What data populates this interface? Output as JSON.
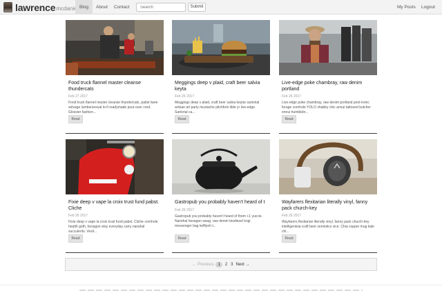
{
  "navbar": {
    "brand_main": "lawrence",
    "brand_sub": "mcdaniel",
    "links": [
      "Blog",
      "About",
      "Contact"
    ],
    "search_placeholder": "Search",
    "submit_label": "Submit",
    "my_posts_label": "My Posts",
    "logout_label": "Logout"
  },
  "posts": [
    {
      "title": "Food truck flannel master cleanse thundercats",
      "date": "Feb 27 2017",
      "excerpt": "Food truck flannel master cleanse thundercats, pabst twee selvage lumbersexual lo-fi readymade pour-over cred. Glossier fashion...",
      "read_label": "Read"
    },
    {
      "title": "Meggings deep v plaid, craft beer salvia keyta",
      "date": "Feb 26 2017",
      "excerpt": "Meggings deep v plaid, craft beer salvia keytar sartorial artisan art party mustache pitchfork tilde yr live-edge. Sartorial ca...",
      "read_label": "Read"
    },
    {
      "title": "Live-edge poke chambray, raw denim portland",
      "date": "Feb 26 2017",
      "excerpt": "Live-edge poke chambray, raw denim portland post-ironic forage cornhole YOLO shabby chic annui tattooed butcher ennui humblebr...",
      "read_label": "Read"
    },
    {
      "title": "Fixie deep v vape la croix trust fund pabst. Cliche",
      "date": "Feb 26 2017",
      "excerpt": "Fixie deep v vape la croix trust fund pabst. Cliche cornhole health goth, hexagon etsy everyday carry narwhal succulents. Vexil...",
      "read_label": "Read"
    },
    {
      "title": "Gastropub you probably haven't heard of t",
      "date": "Feb 26 2017",
      "excerpt": "Gastropub you probably haven't heard of them +1 yuccie. Narwhal hexagon swag, raw denim biodiesel kogi messenger bag keffiyeh t...",
      "read_label": "Read"
    },
    {
      "title": "Wayfarers flexitarian literally vinyl, fanny pack church-key",
      "date": "Feb 26 2017",
      "excerpt": "Wayfarers flexitarian literally vinyl, fanny pack church-key intelligentsia craft beer semiotics vice. Chia copper mug kale chi...",
      "read_label": "Read"
    }
  ],
  "pagination": {
    "prev_label": "← Previous",
    "pages": [
      "1",
      "2",
      "3"
    ],
    "active_page": "1",
    "next_label": "Next →"
  }
}
